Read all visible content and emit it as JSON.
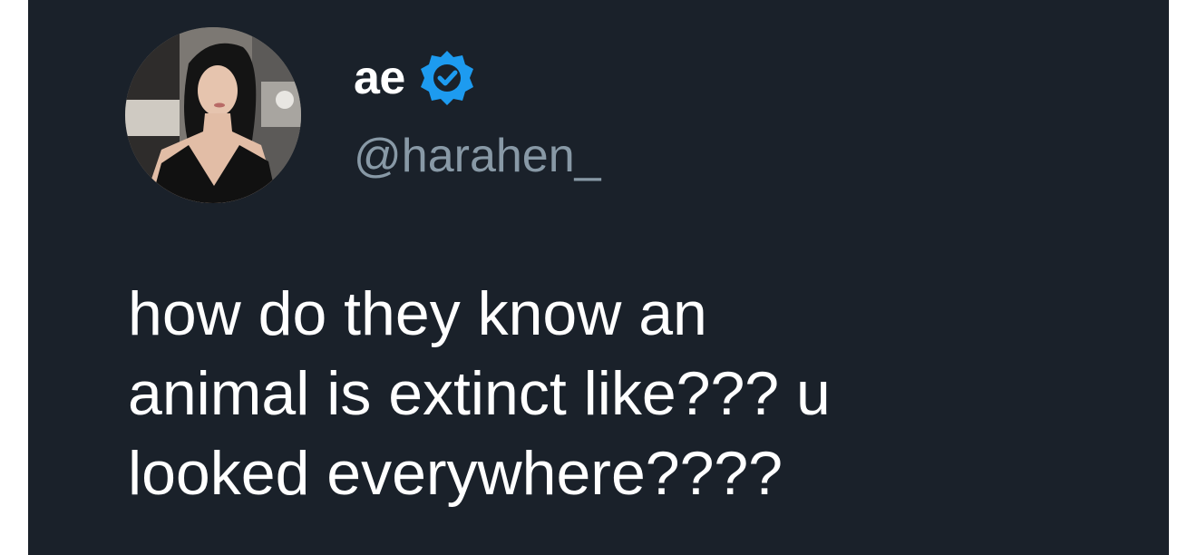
{
  "tweet": {
    "author": {
      "display_name": "ae",
      "handle": "@harahen_",
      "verified": true,
      "avatar_icon": "profile-photo"
    },
    "text_lines": [
      "how do they know an",
      "animal is extinct like??? u",
      "looked everywhere????"
    ]
  },
  "colors": {
    "background": "#1a212a",
    "text": "#ffffff",
    "handle": "#8899a6",
    "verified_badge": "#1d9bf0"
  }
}
